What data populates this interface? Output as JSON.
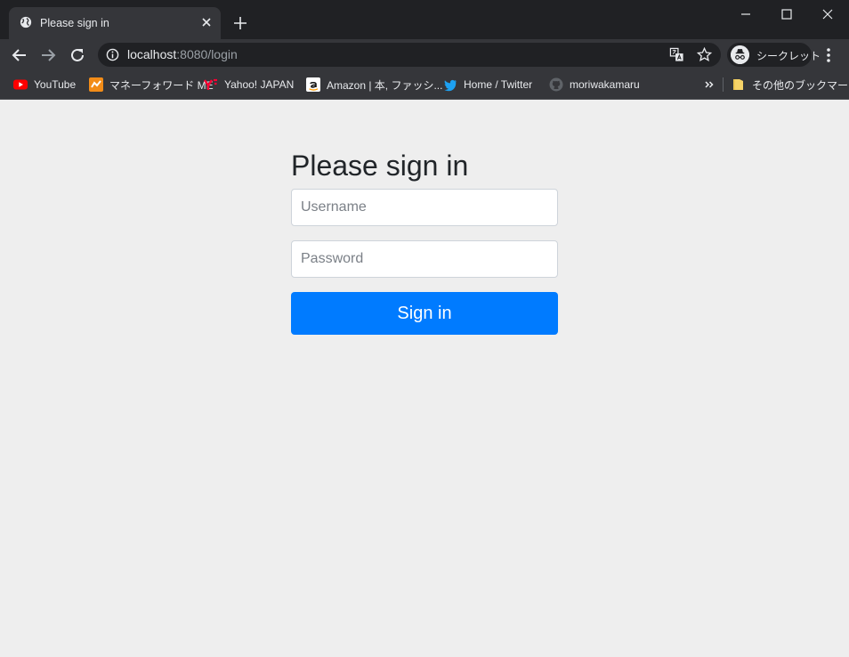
{
  "browser": {
    "tab": {
      "title": "Please sign in"
    },
    "address_bar": {
      "host": "localhost",
      "rest": ":8080/login"
    },
    "profile_label": "シークレット",
    "bookmarks": [
      {
        "label": "YouTube",
        "icon": "youtube-icon"
      },
      {
        "label": "マネーフォワード ME",
        "icon": "moneyforward-icon"
      },
      {
        "label": "Yahoo! JAPAN",
        "icon": "yahoo-icon"
      },
      {
        "label": "Amazon | 本, ファッシ...",
        "icon": "amazon-icon"
      },
      {
        "label": "Home / Twitter",
        "icon": "twitter-icon"
      },
      {
        "label": "moriwakamaru",
        "icon": "github-icon"
      }
    ],
    "other_bookmarks": "その他のブックマーク"
  },
  "page": {
    "heading": "Please sign in",
    "username_placeholder": "Username",
    "password_placeholder": "Password",
    "submit_label": "Sign in"
  },
  "colors": {
    "chrome_dark": "#202124",
    "chrome_tab": "#35363a",
    "page_background": "#eeeeee",
    "primary_button": "#007bff"
  }
}
